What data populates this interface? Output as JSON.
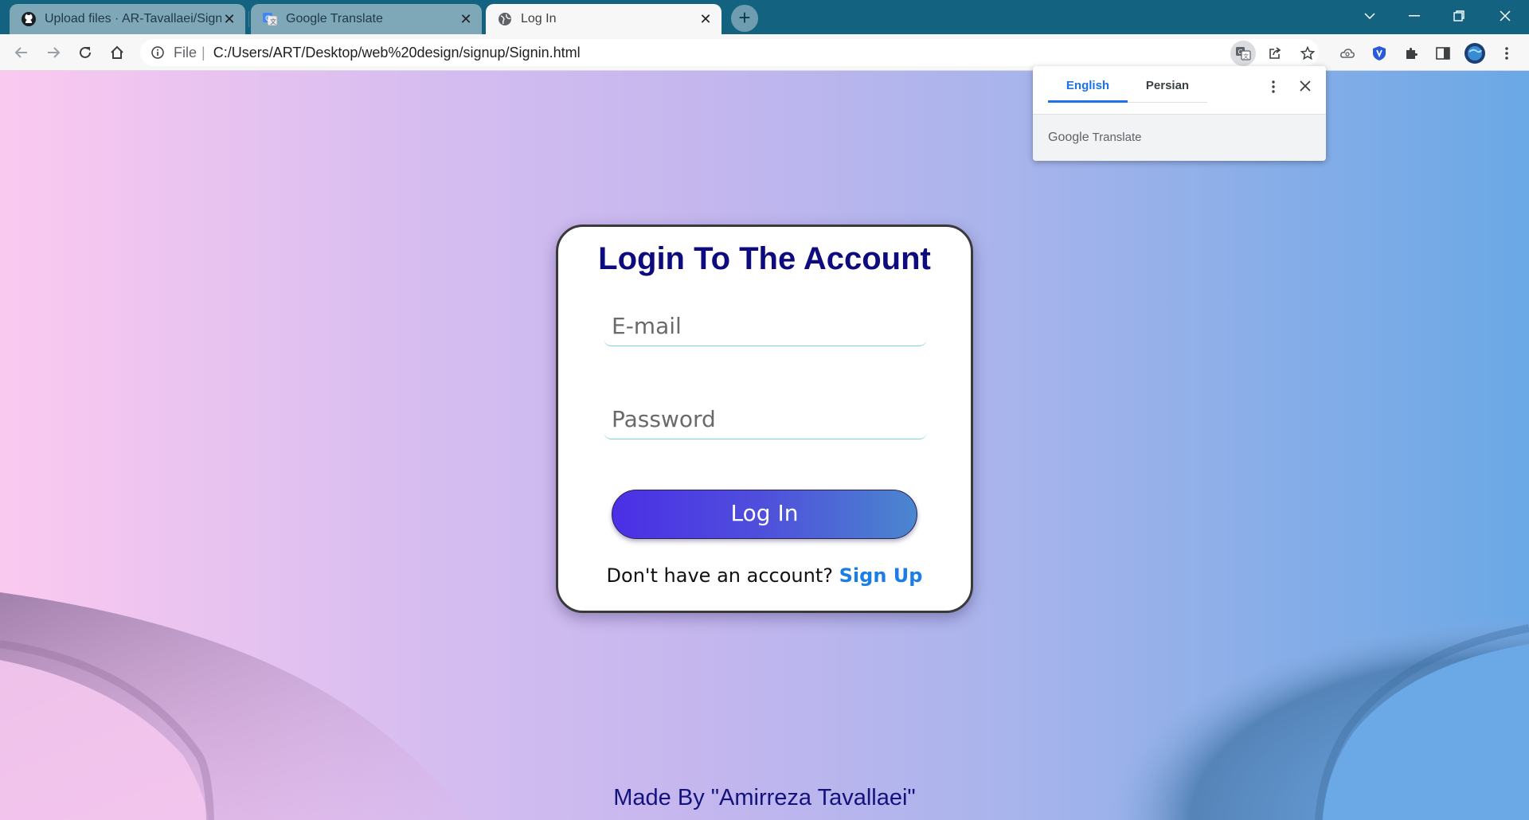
{
  "browser": {
    "tabs": [
      {
        "title": "Upload files · AR-Tavallaei/Signup",
        "icon": "github-icon",
        "active": false
      },
      {
        "title": "Google Translate",
        "icon": "google-translate-icon",
        "active": false
      },
      {
        "title": "Log In",
        "icon": "globe-icon",
        "active": true
      }
    ],
    "address": {
      "scheme_label": "File",
      "separator": "|",
      "url": "C:/Users/ART/Desktop/web%20design/signup/Signin.html"
    },
    "colors": {
      "tabstrip": "#136380",
      "toolbar": "#f7f7f7"
    }
  },
  "translate_popup": {
    "tabs": [
      "English",
      "Persian"
    ],
    "active_tab": "English",
    "brand_google": "Google",
    "brand_translate": "Translate"
  },
  "login": {
    "title": "Login To The Account",
    "email_placeholder": "E-mail",
    "password_placeholder": "Password",
    "button_label": "Log In",
    "signup_prompt": "Don't have an account?",
    "signup_link": "Sign Up"
  },
  "footer": {
    "credit": "Made By \"Amirreza Tavallaei\""
  },
  "colors": {
    "title": "#0e0b7e",
    "link": "#1a7ee6",
    "button_start": "#4b2fe6",
    "button_end": "#4b86cf"
  }
}
